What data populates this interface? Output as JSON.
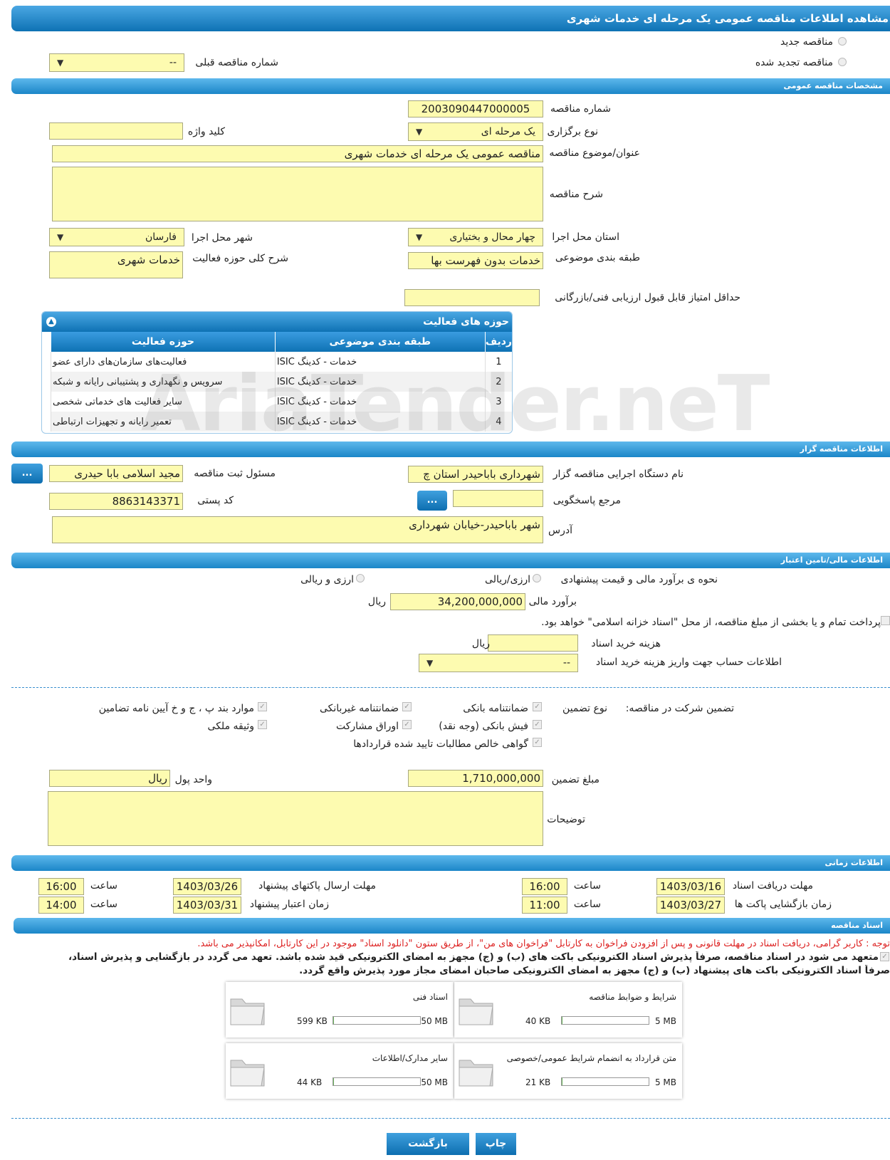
{
  "title": "مشاهده اطلاعات مناقصه عمومی یک مرحله ای خدمات شهری",
  "radio_new": "مناقصه جدید",
  "radio_renew": "مناقصه تجدید شده",
  "prev_number_label": "شماره مناقصه قبلی",
  "prev_number_value": "--",
  "sec_general": "مشخصات مناقصه عمومی",
  "tender_number_label": "شماره مناقصه",
  "tender_number": "2003090447000005",
  "holding_type_label": "نوع برگزاری",
  "holding_type": "یک مرحله ای",
  "keyword_label": "کلید واژه",
  "subject_label": "عنوان/موضوع مناقصه",
  "subject": "مناقصه عمومی یک مرحله ای خدمات شهری",
  "desc_label": "شرح مناقصه",
  "province_label": "استان محل اجرا",
  "province": "چهار محال و بختیاری",
  "city_label": "شهر محل اجرا",
  "city": "فارسان",
  "category_label": "طبقه بندی موضوعی",
  "category": "خدمات بدون فهرست بها",
  "scope_label": "شرح کلی حوزه فعالیت",
  "scope": "خدمات شهری",
  "min_score_label": "حداقل امتیاز قابل قبول ارزیابی فنی/بازرگانی",
  "activity_title": "حوزه های فعالیت",
  "activity_headers": [
    "ردیف",
    "طبقه بندی موضوعی",
    "حوزه فعالیت"
  ],
  "activity_rows": [
    {
      "n": "1",
      "cat": "خدمات - کدینگ ISIC",
      "act": "فعالیت‌های سازمان‌های دارای عضو"
    },
    {
      "n": "2",
      "cat": "خدمات - کدینگ ISIC",
      "act": "سرویس و نگهداری و پشتیبانی رایانه و شبکه"
    },
    {
      "n": "3",
      "cat": "خدمات - کدینگ ISIC",
      "act": "سایر فعالیت های خدماتی شخصی"
    },
    {
      "n": "4",
      "cat": "خدمات - کدینگ ISIC",
      "act": "تعمیر رایانه و تجهیزات ارتباطی"
    }
  ],
  "watermark": "AriaTender.neT",
  "sec_organizer": "اطلاعات مناقصه گزار",
  "org_name_label": "نام دستگاه اجرایی مناقصه گزار",
  "org_name": "شهرداری باباحیدر استان چ",
  "registrar_label": "مسئول ثبت مناقصه",
  "registrar": "مجید اسلامی بابا حیدری",
  "ellipsis": "...",
  "ref_label": "مرجع پاسخگویی",
  "postal_label": "کد پستی",
  "postal": "8863143371",
  "address_label": "آدرس",
  "address": "شهر باباحیدر-خیابان شهرداری",
  "sec_finance": "اطلاعات مالی/تامین اعتبار",
  "estimate_method_label": "نحوه ی برآورد مالی و قیمت پیشنهادی",
  "opt_rial": "ارزی/ریالی",
  "opt_currency": "ارزی و ریالی",
  "estimate_label": "برآورد مالی",
  "estimate": "34,200,000,000",
  "rial": "ریال",
  "treasury_text": "پرداخت تمام و یا بخشی از مبلغ مناقصه، از محل \"اسناد خزانه اسلامی\" خواهد بود.",
  "doc_fee_label": "هزینه خرید اسناد",
  "account_label": "اطلاعات حساب جهت واریز هزینه خرید اسناد",
  "account_value": "--",
  "guarantee_label": "تضمین شرکت در مناقصه:",
  "guarantee_type_label": "نوع تضمین",
  "g1": "ضمانتنامه بانکی",
  "g2": "ضمانتنامه غیربانکی",
  "g3": "موارد بند پ ، ج و خ آیین نامه تضامین",
  "g4": "فیش بانکی (وجه نقد)",
  "g5": "اوراق مشارکت",
  "g6": "وثیقه ملکی",
  "g7": "گواهی خالص مطالبات تایید شده قراردادها",
  "guarantee_amount_label": "مبلغ تضمین",
  "guarantee_amount": "1,710,000,000",
  "currency_label": "واحد پول",
  "currency": "ریال",
  "notes_label": "توضیحات",
  "sec_time": "اطلاعات زمانی",
  "doc_deadline_label": "مهلت دریافت اسناد",
  "doc_deadline": "1403/03/16",
  "time_label": "ساعت",
  "doc_deadline_time": "16:00",
  "send_deadline_label": "مهلت ارسال پاکتهای پیشنهاد",
  "send_deadline": "1403/03/26",
  "send_deadline_time": "16:00",
  "open_label": "زمان بازگشایی پاکت ها",
  "open_date": "1403/03/27",
  "open_time": "11:00",
  "validity_label": "زمان اعتبار پیشنهاد",
  "validity_date": "1403/03/31",
  "validity_time": "14:00",
  "sec_docs": "اسناد مناقصه",
  "notice_red": "توجه : کاربر گرامی، دریافت اسناد در مهلت قانونی و پس از افزودن فراخوان به کارتابل \"فراخوان های من\"، از طریق ستون \"دانلود اسناد\" موجود در این کارتابل، امکانپذیر می باشد.",
  "commit_1": "متعهد می شود در اسناد مناقصه، صرفاً پذیرش اسناد الکترونیکی باکت های (ب) و (ج) مجهز به امضای الکترونیکی قید شده باشد. تعهد می گردد در بازگشایی و پذیرش اسناد،",
  "commit_2": "صرفاً اسناد الکترونیکی باکت های پیشنهاد (ب) و (ج) مجهز به امضای الکترونیکی صاحبان امضای مجاز مورد پذیرش واقع گردد.",
  "docs": [
    {
      "title": "اسناد فنی",
      "used": "599 KB",
      "max": "50 MB",
      "fill": 0.012
    },
    {
      "title": "شرایط و ضوابط مناقصه",
      "used": "40 KB",
      "max": "5 MB",
      "fill": 0.008
    },
    {
      "title": "سایر مدارک/اطلاعات",
      "used": "44 KB",
      "max": "50 MB",
      "fill": 0.001
    },
    {
      "title": "متن قرارداد به انضمام شرایط عمومی/خصوصی",
      "used": "21 KB",
      "max": "5 MB",
      "fill": 0.004
    }
  ],
  "btn_back": "بازگشت",
  "btn_print": "چاپ",
  "colors": {
    "accent": "#1b86c8",
    "field": "#fdfbb0",
    "notice": "#d22"
  }
}
